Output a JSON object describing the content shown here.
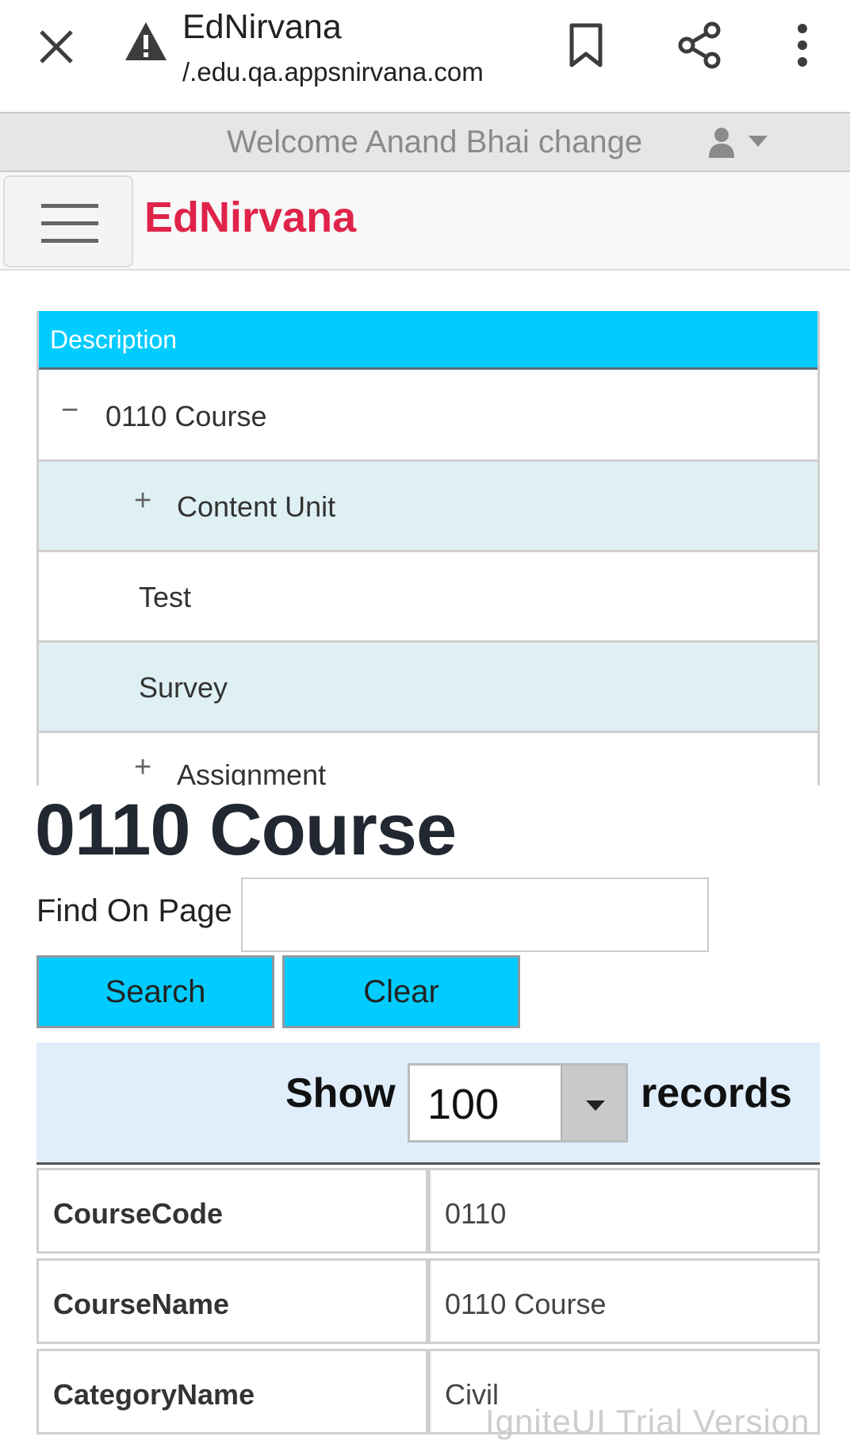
{
  "browser": {
    "title": "EdNirvana",
    "url": "/.edu.qa.appsnirvana.com"
  },
  "top_bar": {
    "welcome_text": "Welcome Anand Bhai change"
  },
  "header": {
    "brand": "EdNirvana"
  },
  "tree": {
    "header": "Description",
    "rows": [
      {
        "expander": "−",
        "label": "0110 Course"
      },
      {
        "expander": "+",
        "label": "Content Unit"
      },
      {
        "expander": "",
        "label": "Test"
      },
      {
        "expander": "",
        "label": "Survey"
      },
      {
        "expander": "+",
        "label": "Assignment"
      }
    ]
  },
  "page": {
    "title": "0110 Course",
    "find_label": "Find On Page",
    "find_value": "",
    "search_label": "Search",
    "clear_label": "Clear"
  },
  "paging": {
    "show_label": "Show",
    "records_value": "100",
    "records_label": "records"
  },
  "details": [
    {
      "key": "CourseCode",
      "value": "0110"
    },
    {
      "key": "CourseName",
      "value": "0110 Course"
    },
    {
      "key": "CategoryName",
      "value": "Civil"
    }
  ],
  "watermark": "IgniteUI Trial Version",
  "colors": {
    "accent": "#00ccff",
    "brand": "#e0234a",
    "row_alt": "#dff0f4",
    "panel_bg": "#e0eefc"
  },
  "icons": [
    "close-icon",
    "warning-icon",
    "bookmark-icon",
    "share-icon",
    "more-vert-icon",
    "user-icon",
    "caret-down-icon",
    "hamburger-menu-icon"
  ]
}
